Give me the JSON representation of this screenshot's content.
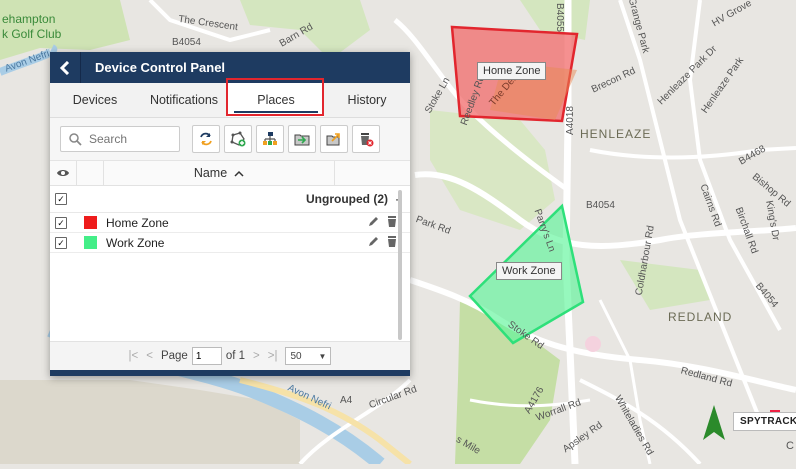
{
  "map": {
    "labels": {
      "golf_a": "ehampton",
      "golf_b": "k Golf Club",
      "the_crescent": "The Crescent",
      "b4054_a": "B4054",
      "barn_rd": "Barn Rd",
      "b4055": "B4055",
      "grange_park": "Grange Park",
      "hv_grove": "HV Grove",
      "henleaze_park_dr": "Henleaze Park Dr",
      "henleaze_park": "Henleaze Park",
      "brecon_rd": "Brecon Rd",
      "henleaze": "HENLEAZE",
      "b4468": "B4468",
      "bishop_rd": "Bishop Rd",
      "b4054_b": "B4054",
      "cairns_rd": "Cairns Rd",
      "birchall_rd": "Birchall Rd",
      "kings_dr": "King's Dr",
      "coldharbour_rd": "Coldharbour Rd",
      "redland": "REDLAND",
      "b4054_c": "B4054",
      "redland_rd": "Redland Rd",
      "a4018": "A4018",
      "stoke_ln": "Stoke Ln",
      "reedley_rd": "Reedley Rd",
      "the_dell": "The Dell",
      "parrys_ln": "Parry's Ln",
      "park_rd": "Park Rd",
      "stoke_rd": "Stoke Rd",
      "a4176": "A4176",
      "worrall_rd": "Worrall Rd",
      "apsley_rd": "Apsley Rd",
      "whiteladies_rd": "Whiteladies Rd",
      "circular_rd": "Circular Rd",
      "avon_nefri_a": "Avon Nefri",
      "avon_nefri_b": "Avon Nefri",
      "a4": "A4",
      "stokes_mile": "s Mile"
    },
    "zones": {
      "home": {
        "label": "Home Zone",
        "color": "#f26b6b"
      },
      "work": {
        "label": "Work Zone",
        "color": "#5ef59a"
      }
    },
    "spytrack": "SPYTRACK",
    "corner": "C"
  },
  "panel": {
    "title": "Device Control Panel",
    "tabs": [
      "Devices",
      "Notifications",
      "Places",
      "History"
    ],
    "active_tab": "Places",
    "search_placeholder": "Search",
    "column_name": "Name",
    "group": {
      "label": "Ungrouped (2)"
    },
    "items": [
      {
        "name": "Home Zone",
        "color": "#ee1c1c"
      },
      {
        "name": "Work Zone",
        "color": "#44ee88"
      }
    ],
    "pager": {
      "page_label": "Page",
      "page": "1",
      "of_label": "of 1",
      "per_page": "50"
    }
  }
}
